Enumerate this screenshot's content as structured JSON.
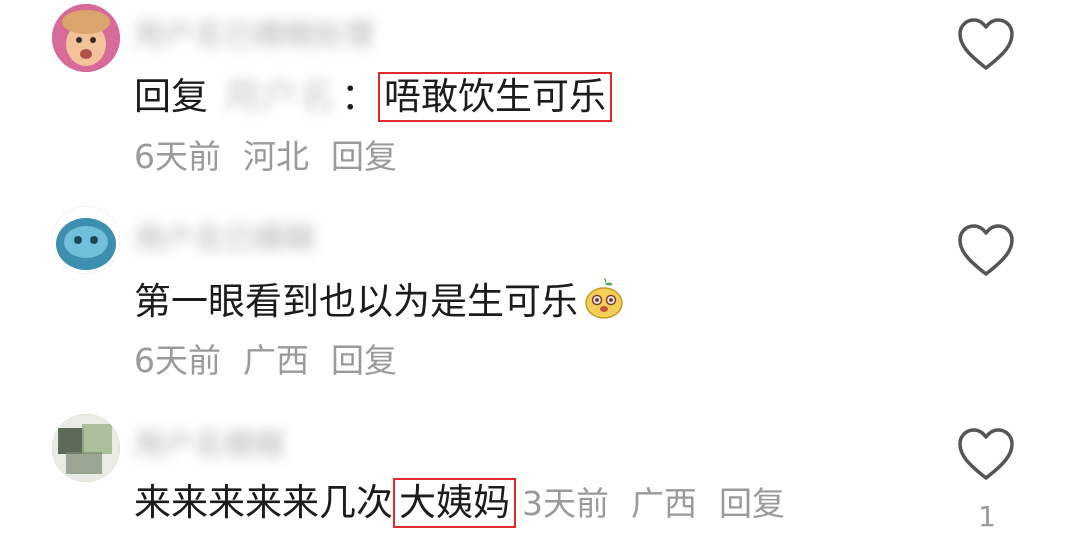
{
  "comments": [
    {
      "username": "用户名已模糊处理",
      "reply_prefix": "回复",
      "mention": "用户名",
      "colon": "：",
      "text": "唔敢饮生可乐",
      "time": "6天前",
      "location": "河北",
      "reply_label": "回复",
      "avatar_color": "#d86a9a"
    },
    {
      "username": "用户名已模糊",
      "text": "第一眼看到也以为是生可乐",
      "emoji_icon": "gourd-face-emoji-icon",
      "time": "6天前",
      "location": "广西",
      "reply_label": "回复",
      "avatar_color": "#3d8fb0"
    },
    {
      "username": "用户名模糊",
      "text_prefix": "来来来来来几次",
      "text_highlight": "大姨妈",
      "time": "3天前",
      "location": "广西",
      "reply_label": "回复",
      "like_count": "1",
      "avatar_color": "#6f8a5f"
    }
  ],
  "icons": {
    "like": "heart-outline-icon"
  },
  "colors": {
    "highlight_border": "#e32a2a",
    "meta_text": "#9a9a9a"
  }
}
